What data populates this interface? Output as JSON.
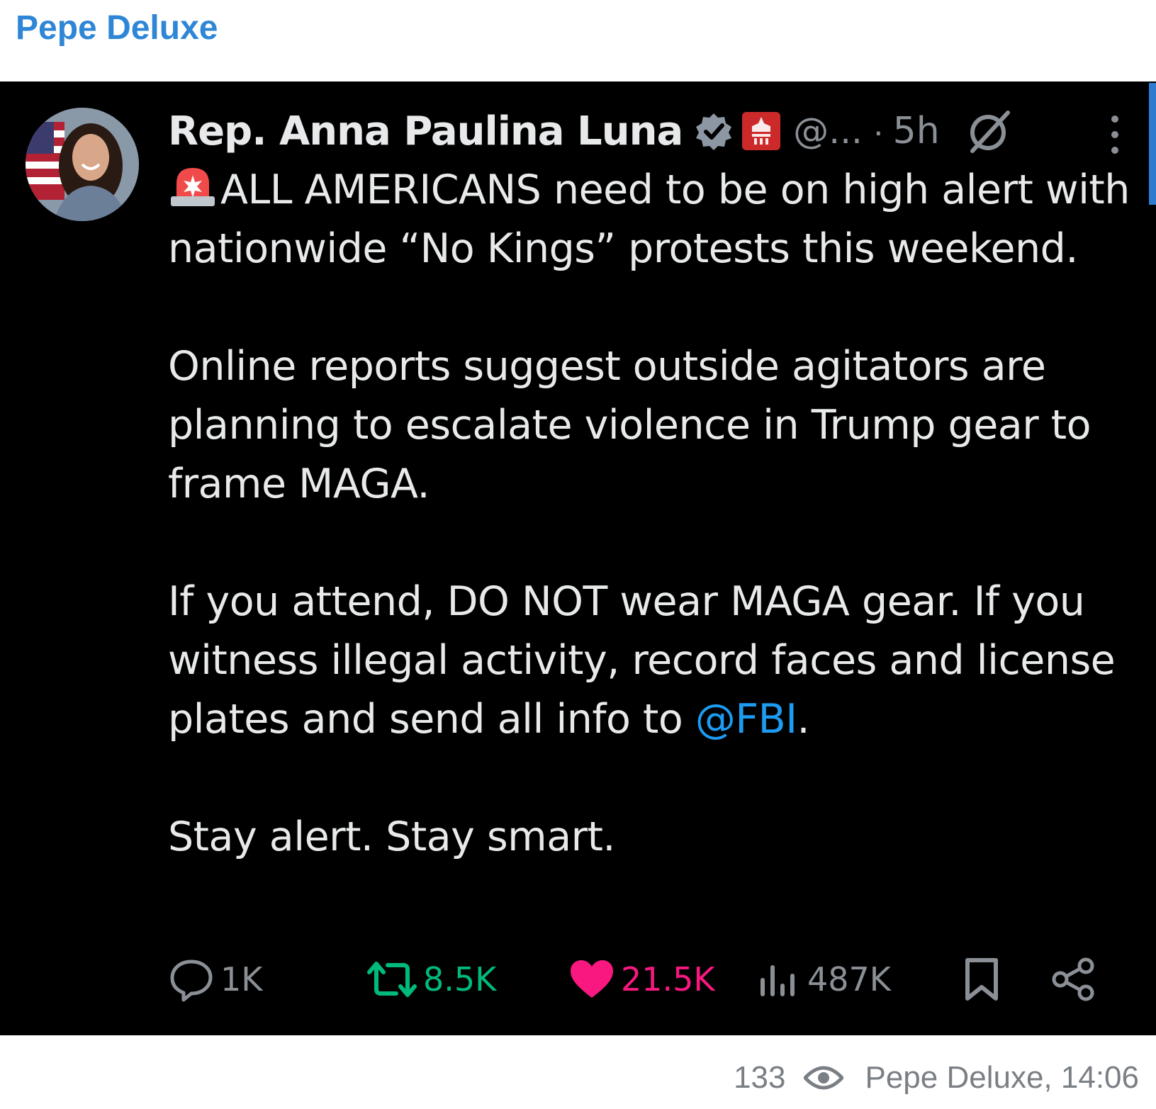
{
  "channel": {
    "name": "Pepe Deluxe"
  },
  "tweet": {
    "author_name": "Rep. Anna Paulina Luna",
    "handle": "@...",
    "separator": "·",
    "time": "5h",
    "paragraphs": [
      "ALL AMERICANS need to be on high alert with nationwide “No Kings” protests this weekend.",
      "Online reports suggest outside agitators are planning to escalate violence in Trump gear to frame MAGA.",
      "If you attend, DO NOT wear MAGA gear. If you witness illegal activity, record faces and license plates and send all info to ",
      "Stay alert. Stay smart."
    ],
    "mention": "@FBI",
    "mention_suffix": ".",
    "actions": {
      "replies": "1K",
      "reposts": "8.5K",
      "likes": "21.5K",
      "views": "487K"
    },
    "colors": {
      "background": "#000000",
      "text": "#e7e9ea",
      "muted": "#8b9096",
      "mention": "#1d9bf0",
      "repost": "#00ba7c",
      "like": "#f91880"
    },
    "icons": [
      "siren-emoji-icon",
      "verified-badge-icon",
      "government-badge-icon",
      "grok-icon",
      "more-options-icon",
      "reply-icon",
      "repost-icon",
      "heart-icon",
      "views-icon",
      "bookmark-icon",
      "share-icon"
    ]
  },
  "footer": {
    "views": "133",
    "signature": "Pepe Deluxe, 14:06"
  },
  "accent_color": "#2f86d6"
}
